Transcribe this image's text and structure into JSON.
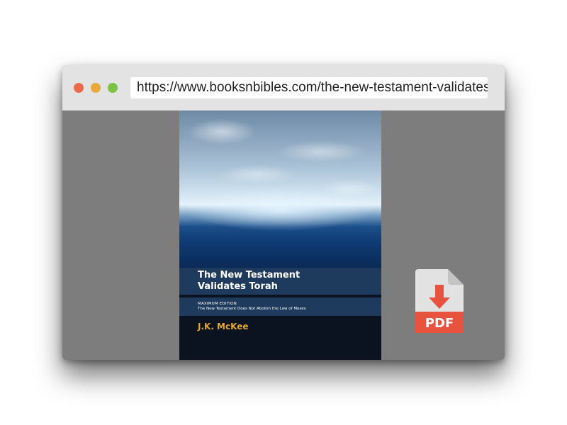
{
  "browser": {
    "url": "https://www.booksnbibles.com/the-new-testament-validates-torah",
    "traffic_lights": {
      "close_color": "#ec6a4c",
      "minimize_color": "#e9a93a",
      "zoom_color": "#7cc142"
    }
  },
  "book": {
    "title_line_1": "The New Testament",
    "title_line_2": "Validates Torah",
    "edition": "MAXIMUM EDITION",
    "subtitle": "The New Testament Does Not Abolish the Law of Moses",
    "author": "J.K. McKee",
    "author_color": "#e1a62a",
    "band_color": "#1e3a5c"
  },
  "download": {
    "icon": "pdf-download-icon",
    "label": "PDF",
    "accent_color": "#e8533f"
  }
}
